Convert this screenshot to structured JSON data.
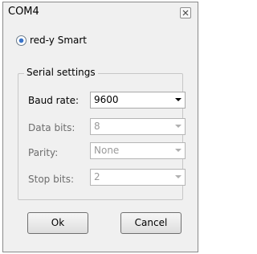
{
  "window": {
    "title": "COM4",
    "close_icon": "close-icon"
  },
  "device": {
    "label": "red-y Smart",
    "selected": true
  },
  "serial_settings": {
    "legend": "Serial settings",
    "fields": [
      {
        "label": "Baud rate:",
        "value": "9600",
        "enabled": true
      },
      {
        "label": "Data bits:",
        "value": "8",
        "enabled": false
      },
      {
        "label": "Parity:",
        "value": "None",
        "enabled": false
      },
      {
        "label": "Stop bits:",
        "value": "2",
        "enabled": false
      }
    ]
  },
  "buttons": {
    "ok": "Ok",
    "cancel": "Cancel"
  }
}
